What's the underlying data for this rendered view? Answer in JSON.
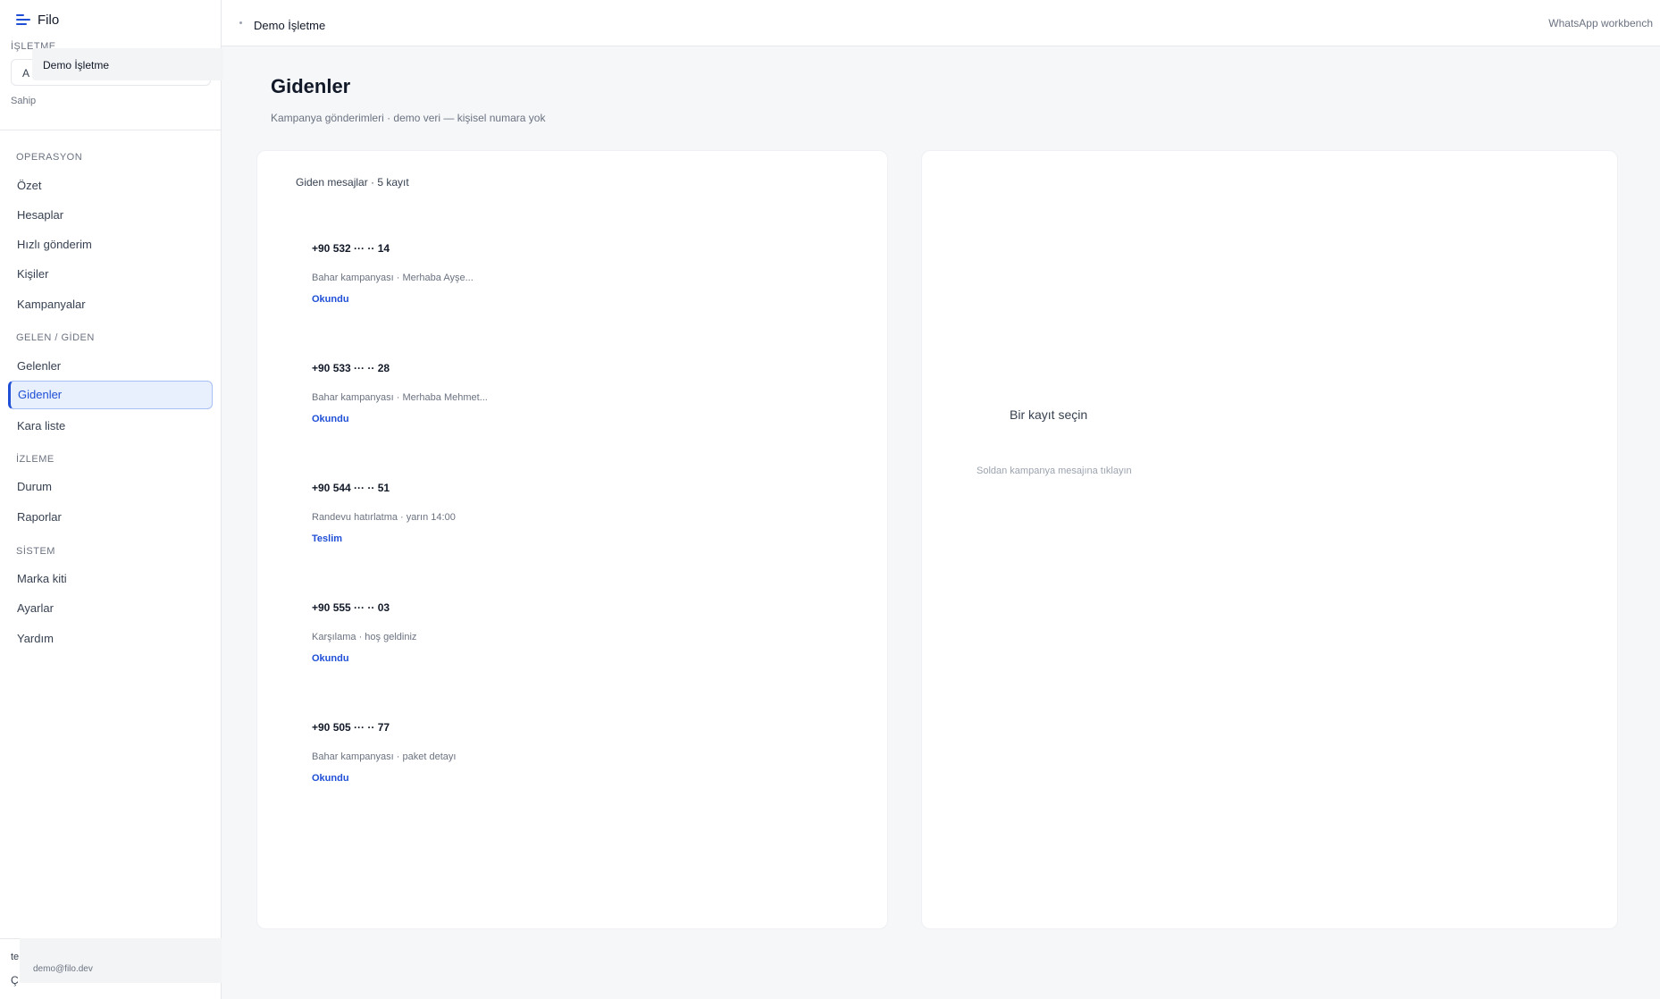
{
  "app": {
    "title": "Filo"
  },
  "sidebar": {
    "business_label": "İŞLETME",
    "business_initial": "A",
    "business_name": "Demo İşletme",
    "role": "Sahip",
    "sections": [
      {
        "title": "OPERASYON",
        "items": [
          "Özet",
          "Hesaplar",
          "Hızlı gönderim",
          "Kişiler",
          "Kampanyalar"
        ]
      },
      {
        "title": "GELEN / GİDEN",
        "items": [
          "Gelenler",
          "Gidenler",
          "Kara liste"
        ]
      },
      {
        "title": "İZLEME",
        "items": [
          "Durum",
          "Raporlar"
        ]
      },
      {
        "title": "SİSTEM",
        "items": [
          "Marka kiti",
          "Ayarlar",
          "Yardım"
        ]
      }
    ],
    "active_item": "Gidenler",
    "footer_line1": "te",
    "footer_line2": "Ç",
    "footer_email": "demo@filo.dev"
  },
  "topbar": {
    "breadcrumb": "Demo İşletme",
    "right_label": "WhatsApp workbench"
  },
  "page": {
    "title": "Gidenler",
    "subtitle": "Kampanya gönderimleri · demo veri — kişisel numara yok"
  },
  "list": {
    "header": "Giden mesajlar · 5 kayıt",
    "items": [
      {
        "phone": "+90 532 ··· ·· 14",
        "preview": "Bahar kampanyası · Merhaba Ayşe...",
        "status": "Okundu"
      },
      {
        "phone": "+90 533 ··· ·· 28",
        "preview": "Bahar kampanyası · Merhaba Mehmet...",
        "status": "Okundu"
      },
      {
        "phone": "+90 544 ··· ·· 51",
        "preview": "Randevu hatırlatma · yarın 14:00",
        "status": "Teslim"
      },
      {
        "phone": "+90 555 ··· ·· 03",
        "preview": "Karşılama · hoş geldiniz",
        "status": "Okundu"
      },
      {
        "phone": "+90 505 ··· ·· 77",
        "preview": "Bahar kampanyası · paket detayı",
        "status": "Okundu"
      }
    ]
  },
  "detail": {
    "empty_title": "Bir kayıt seçin",
    "empty_subtitle": "Soldan kampanya mesajına tıklayın"
  },
  "colors": {
    "accent": "#1f4fd6",
    "active_bg": "#e8effd",
    "background": "#f6f7f9"
  }
}
